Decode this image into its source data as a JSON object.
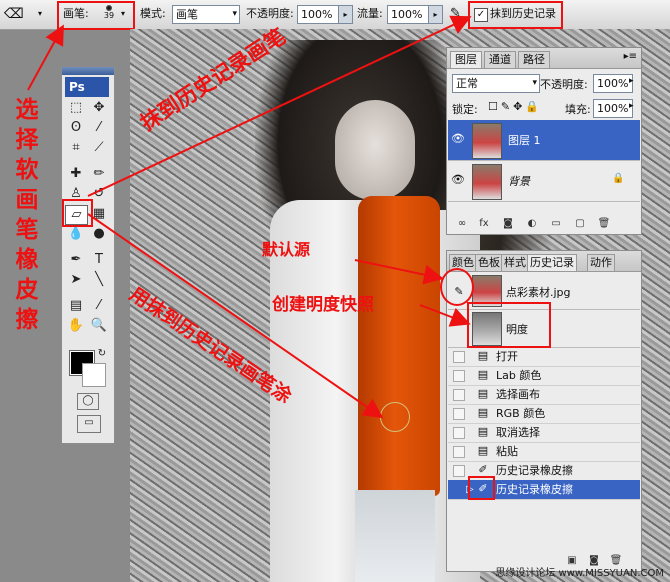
{
  "options_bar": {
    "brush_label": "画笔:",
    "brush_size": "39",
    "mode_label": "模式:",
    "mode_value": "画笔",
    "opacity_label": "不透明度:",
    "opacity_value": "100%",
    "flow_label": "流量:",
    "flow_value": "100%",
    "erase_to_history_label": "抹到历史记录"
  },
  "toolbox": {
    "logo": "Ps"
  },
  "annotations": {
    "select_eraser": "选择软画笔橡皮擦",
    "erase_history_brush": "抹到历史记录画笔",
    "default_source": "默认源",
    "create_snapshot": "创建明度快照",
    "paint_with": "用抹到历史记录画笔涂"
  },
  "layers_panel": {
    "tabs": [
      "图层",
      "通道",
      "路径"
    ],
    "blend_mode": "正常",
    "opacity_label": "不透明度:",
    "opacity_value": "100%",
    "lock_label": "锁定:",
    "fill_label": "填充:",
    "fill_value": "100%",
    "layers": [
      {
        "name": "图层 1"
      },
      {
        "name": "背景"
      }
    ]
  },
  "history_panel": {
    "tabs": [
      "颜色",
      "色板",
      "样式",
      "历史记录",
      "动作"
    ],
    "snapshots": [
      {
        "name": "点彩素材.jpg"
      },
      {
        "name": "明度"
      }
    ],
    "states": [
      {
        "name": "打开"
      },
      {
        "name": "Lab 颜色"
      },
      {
        "name": "选择画布"
      },
      {
        "name": "RGB 颜色"
      },
      {
        "name": "取消选择"
      },
      {
        "name": "粘贴"
      },
      {
        "name": "历史记录橡皮擦"
      },
      {
        "name": "历史记录橡皮擦"
      }
    ]
  },
  "watermark": "思缘设计论坛 www.MISSYUAN.COM",
  "colors": {
    "annotation_red": "#e11111",
    "selection_blue": "#3a64c4",
    "sweater_orange": "#e4560a"
  }
}
